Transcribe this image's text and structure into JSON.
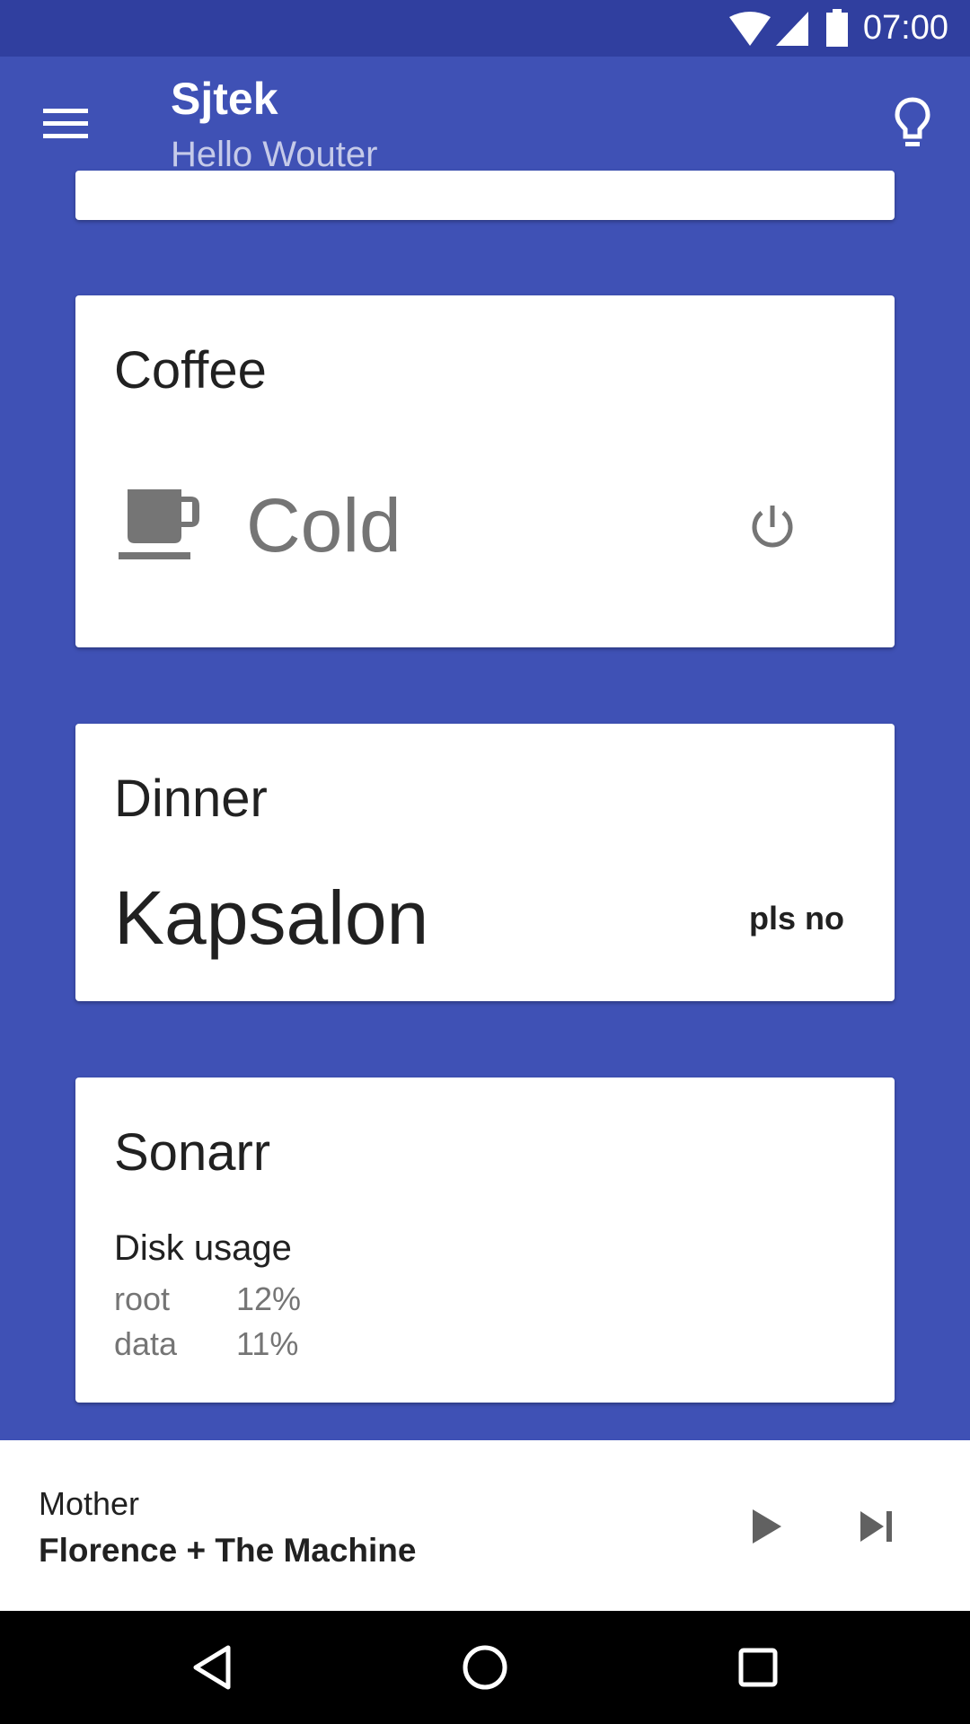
{
  "status_bar": {
    "time": "07:00",
    "icons": [
      "wifi-icon",
      "signal-icon",
      "battery-icon"
    ]
  },
  "app_bar": {
    "title": "Sjtek",
    "subtitle": "Hello Wouter",
    "menu_icon": "menu-icon",
    "action_icon": "lightbulb-icon"
  },
  "colors": {
    "primary": "#3F51B5",
    "primary_dark": "#303F9F",
    "subtitle": "#C5CAE9"
  },
  "coffee": {
    "title": "Coffee",
    "status": "Cold",
    "icon": "coffee-cup-icon",
    "action_icon": "power-icon"
  },
  "dinner": {
    "title": "Dinner",
    "meal": "Kapsalon",
    "action": "pls no"
  },
  "sonarr": {
    "title": "Sonarr",
    "section": "Disk usage",
    "disks": [
      {
        "name": "root",
        "usage": "12%"
      },
      {
        "name": "data",
        "usage": "11%"
      }
    ]
  },
  "player": {
    "track": "Mother",
    "artist": "Florence + The Machine"
  },
  "navigation": {
    "back": "back-icon",
    "home": "home-icon",
    "recents": "recents-icon"
  }
}
